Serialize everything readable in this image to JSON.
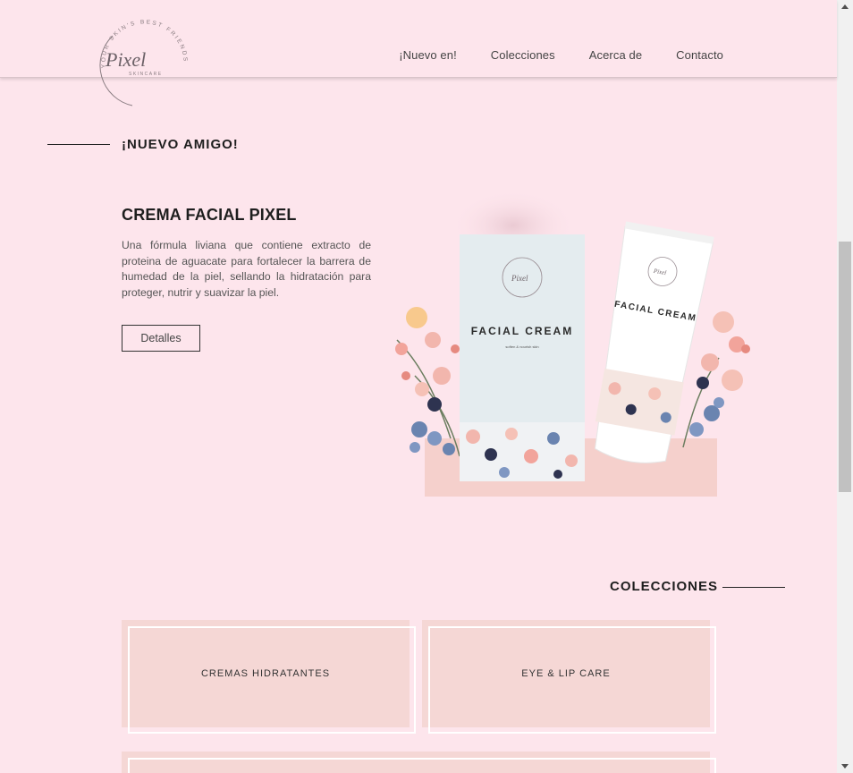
{
  "brand": {
    "logo_text": "Pixel",
    "logo_sub": "SKINCARE",
    "logo_ring_text": "YOUR SKIN'S BEST FRIENDS"
  },
  "nav": {
    "items": [
      {
        "label": "¡Nuevo en!"
      },
      {
        "label": "Colecciones"
      },
      {
        "label": "Acerca de"
      },
      {
        "label": "Contacto"
      }
    ]
  },
  "new_section": {
    "title": "¡NUEVO AMIGO!",
    "product_title": "CREMA FACIAL PIXEL",
    "description": "Una fórmula liviana que contiene extracto de proteina de aguacate para fortalecer la barrera de humedad de la piel, sellando la hidratación para proteger, nutrir y suavizar la piel.",
    "button_label": "Detalles",
    "box_label": "FACIAL CREAM",
    "box_sub": "soften & nourish skin",
    "tube_label": "FACIAL CREAM"
  },
  "collections": {
    "title": "COLECCIONES",
    "cards": [
      {
        "label": "CREMAS HIDRATANTES"
      },
      {
        "label": "EYE & LIP CARE"
      }
    ]
  },
  "colors": {
    "background": "#fde5ec",
    "card": "#f5d7d5",
    "text_dark": "#1e1e1e"
  }
}
